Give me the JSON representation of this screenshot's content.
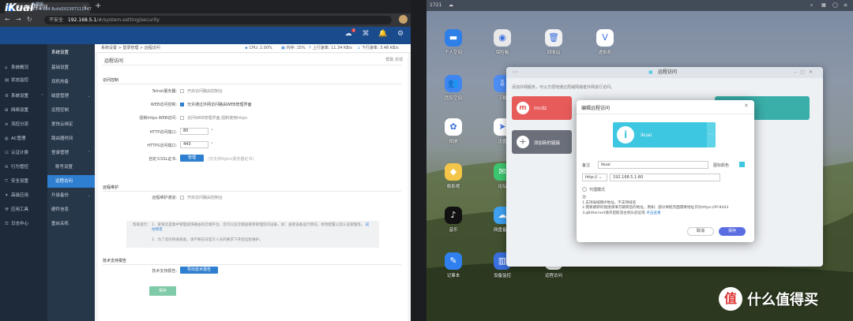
{
  "browser": {
    "tab_title": "iKuai 远程访问",
    "favicon": "iK",
    "insecure_label": "不安全",
    "url_host": "192.168.5.1",
    "url_path": "/#/system-setting/security"
  },
  "app": {
    "logo": "iKuai",
    "edition": "免费版",
    "version": "3.7.4 x64 Build202307111447"
  },
  "sidebar": {
    "items": [
      {
        "label": "系统概况",
        "icon": "home-icon"
      },
      {
        "label": "状态监控",
        "icon": "monitor-icon"
      },
      {
        "label": "系统设置",
        "icon": "gear-icon",
        "expand": "⌃"
      },
      {
        "label": "网络设置",
        "icon": "network-icon"
      },
      {
        "label": "流控分流",
        "icon": "flow-icon"
      },
      {
        "label": "AC管理",
        "icon": "ac-icon"
      },
      {
        "label": "认证计费",
        "icon": "auth-icon"
      },
      {
        "label": "行为管控",
        "icon": "behavior-icon"
      },
      {
        "label": "安全设置",
        "icon": "shield-icon"
      },
      {
        "label": "高级应用",
        "icon": "advanced-icon"
      },
      {
        "label": "应用工具",
        "icon": "tools-icon"
      },
      {
        "label": "日志中心",
        "icon": "log-icon"
      }
    ]
  },
  "subnav": {
    "items": [
      {
        "label": "系统设置",
        "type": "head"
      },
      {
        "label": "基础设置",
        "type": "item"
      },
      {
        "label": "双机热备",
        "type": "item"
      },
      {
        "label": "磁盘管理",
        "type": "item",
        "expand": "⌄"
      },
      {
        "label": "远程控制",
        "type": "item"
      },
      {
        "label": "爱快云绑定",
        "type": "item"
      },
      {
        "label": "路由器时间",
        "type": "item"
      },
      {
        "label": "登录管理",
        "type": "item",
        "expand": "⌃"
      },
      {
        "label": "账号设置",
        "type": "sub"
      },
      {
        "label": "远程访问",
        "type": "sub",
        "active": true
      },
      {
        "label": "升级备份",
        "type": "item",
        "expand": "⌄"
      },
      {
        "label": "硬件信息",
        "type": "item"
      },
      {
        "label": "重启关机",
        "type": "item"
      }
    ]
  },
  "status": {
    "breadcrumb": "系统设置 > 登录管理 > 远程访问",
    "cpu": "CPU: 2.00%",
    "mem": "内存: 15%",
    "up": "上行速率: 11.34 KB/s",
    "down": "下行速率: 3.48 KB/s"
  },
  "page": {
    "title": "远程访问",
    "links": "帮助    反馈",
    "section_access": "访问控制",
    "telnet_label": "Telnet服务器:",
    "telnet_text": "开启访问路由控制台",
    "web_label": "WEB访问控制:",
    "web_text": "允许通过外网访问路由WEB管理界面",
    "https_label": "强制https WEB访问:",
    "https_text": "访问WEB管理界面,强制使用https",
    "http_port_label": "HTTP访问端口:",
    "http_port": "80",
    "https_port_label": "HTTPS访问端口:",
    "https_port": "443",
    "star": "*",
    "ssl_label": "自定义SSL证书:",
    "ssl_button": "管理",
    "ssl_hint": "(仅支持Nginx服务器证书)",
    "section_remote": "远程维护",
    "remote_label": "远程维护通道:",
    "remote_text": "开启访问路由控制台",
    "help_prefix": "帮助提示：",
    "help_1": "1、爱快云是集中管理爱快路由的云端平台，您可以在云端查看和管理您的设备，如：查看设备运行情况，修改配置以及认证管理等。",
    "help_link": "前往绑定",
    "help_2": "2、为了您的快速排查，请不要在非官方人员的要求下开启远程维护。",
    "section_support": "技术支持报告",
    "support_label": "技术支持报告:",
    "support_button": "导出技术报告",
    "save": "保存"
  },
  "desktop": {
    "topbar_text": "1721",
    "icons": [
      {
        "label": "个人空间",
        "color": "#2f7fe8",
        "glyph": "▬"
      },
      {
        "label": "保险箱",
        "color": "#e8e8e8",
        "glyph": "◉"
      },
      {
        "label": "回收站",
        "color": "#f0f0f0",
        "glyph": "🗑"
      },
      {
        "label": "虚拟机",
        "color": "#ffffff",
        "glyph": "V"
      },
      {
        "label": "团队空间",
        "color": "#3f86f0",
        "glyph": "👥"
      },
      {
        "label": "下载",
        "color": "#4d8cf2",
        "glyph": "⇩"
      },
      {
        "label": "相册",
        "color": "#ffffff",
        "glyph": "✿"
      },
      {
        "label": "迅雷",
        "color": "#ffffff",
        "glyph": "➤"
      },
      {
        "label": "极影视",
        "color": "#f3c64a",
        "glyph": "◆"
      },
      {
        "label": "论坛",
        "color": "#3cc66f",
        "glyph": "✉"
      },
      {
        "label": "音乐",
        "color": "#111111",
        "glyph": "♪"
      },
      {
        "label": "网盘备份",
        "color": "#3fa0f0",
        "glyph": "☁"
      },
      {
        "label": "记事本",
        "color": "#2f80ee",
        "glyph": "✎"
      },
      {
        "label": "设备监控",
        "color": "#3a6fe0",
        "glyph": "▥"
      },
      {
        "label": "远程访问",
        "color": "#ffffff",
        "glyph": "i"
      }
    ]
  },
  "dsm_window": {
    "title": "远程访问",
    "desc": "添加外网服务，可以方便地通过局域网或者外网进行访问。",
    "tile_label": "mcdz",
    "add_label": "添加新的链接"
  },
  "dialog": {
    "title": "编辑远程访问",
    "close": "✕",
    "card_name": "ikuai",
    "card_glyph": "i",
    "note_label": "备注",
    "note_value": "ikuai",
    "color_label": "图标颜色",
    "protocol": "http:// ⌄",
    "address": "192.168.5.1:80",
    "proxy_label": "代理模式",
    "notes_title": "注:",
    "note1": "1.支持局域网IP地址，不支持域名",
    "note2": "2.需要跳转的链接请填写跳转后的地址，例如：部分导航页面需要地址作为https://IP:8443",
    "note3": "3.qBittorrent请开启取消主机头验证等",
    "note3_link": "点击查看",
    "cancel": "取消",
    "save": "保存"
  },
  "watermark": {
    "icon": "值",
    "text": "什么值得买"
  }
}
